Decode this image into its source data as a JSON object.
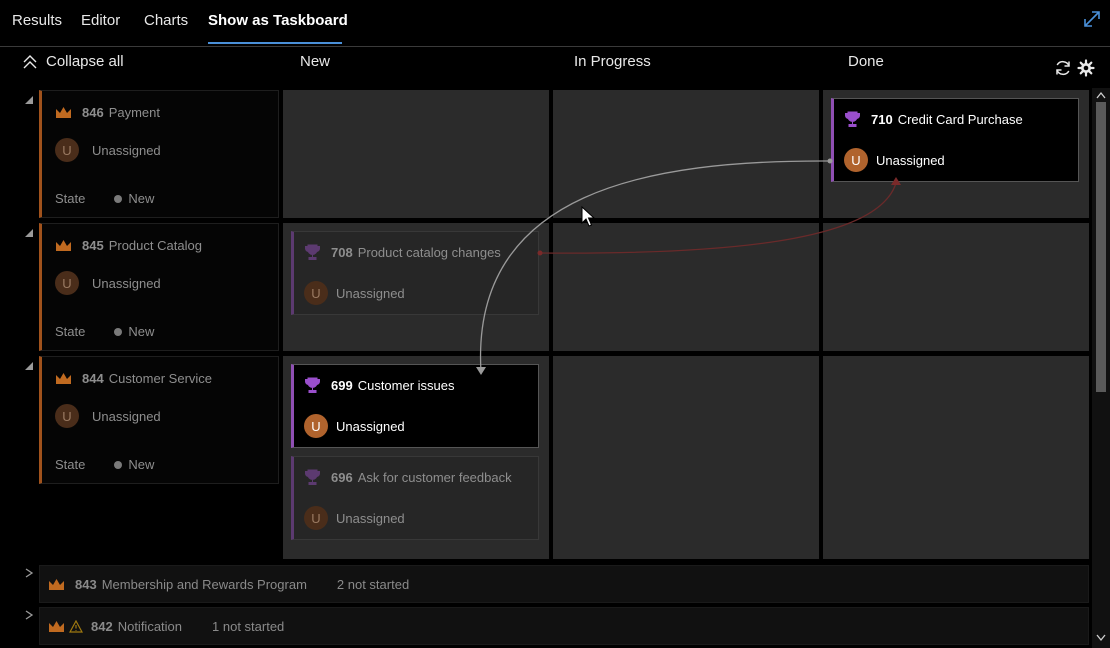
{
  "tabs": [
    {
      "label": "Results"
    },
    {
      "label": "Editor"
    },
    {
      "label": "Charts"
    },
    {
      "label": "Show as Taskboard",
      "active": true
    }
  ],
  "header": {
    "collapse_all": "Collapse all",
    "columns": [
      "New",
      "In Progress",
      "Done"
    ]
  },
  "swimlanes": [
    {
      "id": "846",
      "title": "Payment",
      "assignee": "Unassigned",
      "avatar": "U",
      "state_label": "State",
      "state": "New"
    },
    {
      "id": "845",
      "title": "Product Catalog",
      "assignee": "Unassigned",
      "avatar": "U",
      "state_label": "State",
      "state": "New"
    },
    {
      "id": "844",
      "title": "Customer Service",
      "assignee": "Unassigned",
      "avatar": "U",
      "state_label": "State",
      "state": "New"
    }
  ],
  "cards": [
    {
      "id": "710",
      "title": "Credit Card Purchase",
      "assignee": "Unassigned",
      "avatar": "U",
      "lane": "846",
      "column": "Done"
    },
    {
      "id": "708",
      "title": "Product catalog changes",
      "assignee": "Unassigned",
      "avatar": "U",
      "lane": "845",
      "column": "New"
    },
    {
      "id": "699",
      "title": "Customer issues",
      "assignee": "Unassigned",
      "avatar": "U",
      "lane": "844",
      "column": "New"
    },
    {
      "id": "696",
      "title": "Ask for customer feedback",
      "assignee": "Unassigned",
      "avatar": "U",
      "lane": "844",
      "column": "New"
    }
  ],
  "collapsed_lanes": [
    {
      "id": "843",
      "title": "Membership and Rewards Program",
      "summary": "2 not started"
    },
    {
      "id": "842",
      "title": "Notification",
      "summary": "1 not started"
    }
  ],
  "colors": {
    "accent": "#4a90d9",
    "epic": "#a0521c",
    "feature": "#8f4fb3",
    "avatar": "#b0632d",
    "cell": "#2b2b2b"
  }
}
